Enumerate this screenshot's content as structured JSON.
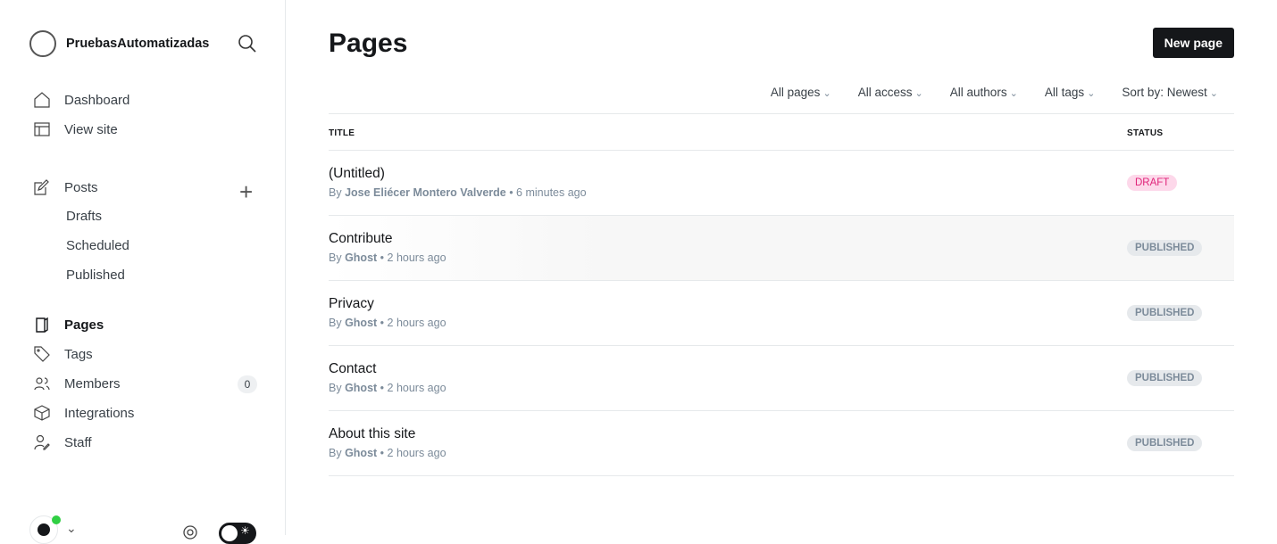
{
  "site": {
    "name": "PruebasAutomatizadas"
  },
  "nav": {
    "dashboard": "Dashboard",
    "view_site": "View site",
    "posts": "Posts",
    "drafts": "Drafts",
    "scheduled": "Scheduled",
    "published": "Published",
    "pages": "Pages",
    "tags": "Tags",
    "members": "Members",
    "members_count": "0",
    "integrations": "Integrations",
    "staff": "Staff"
  },
  "main": {
    "title": "Pages",
    "new_button": "New page",
    "filters": [
      "All pages",
      "All access",
      "All authors",
      "All tags",
      "Sort by: Newest"
    ],
    "columns": {
      "title": "TITLE",
      "status": "STATUS"
    },
    "rows": [
      {
        "title": "(Untitled)",
        "by": "By",
        "author": "Jose Eliécer Montero Valverde",
        "time": "• 6 minutes ago",
        "status": "DRAFT"
      },
      {
        "title": "Contribute",
        "by": "By",
        "author": "Ghost",
        "time": "• 2 hours ago",
        "status": "PUBLISHED"
      },
      {
        "title": "Privacy",
        "by": "By",
        "author": "Ghost",
        "time": "• 2 hours ago",
        "status": "PUBLISHED"
      },
      {
        "title": "Contact",
        "by": "By",
        "author": "Ghost",
        "time": "• 2 hours ago",
        "status": "PUBLISHED"
      },
      {
        "title": "About this site",
        "by": "By",
        "author": "Ghost",
        "time": "• 2 hours ago",
        "status": "PUBLISHED"
      }
    ]
  }
}
